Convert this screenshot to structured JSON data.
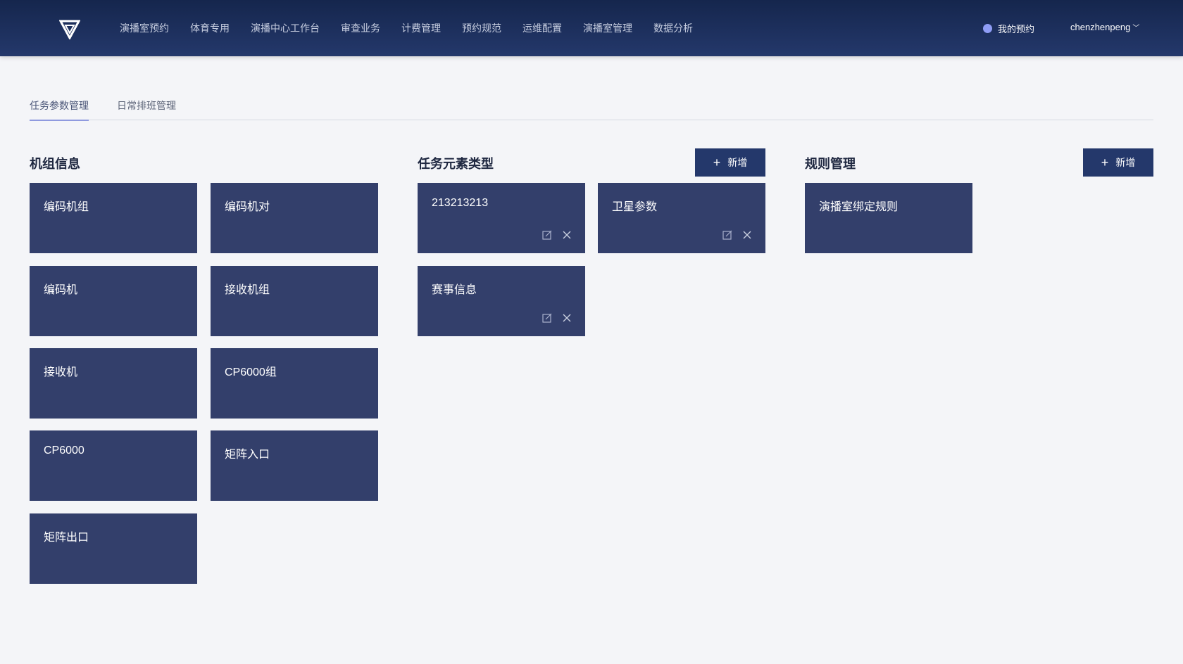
{
  "nav": {
    "logo_icon": "triangle-logo-icon",
    "items": [
      "演播室预约",
      "体育专用",
      "演播中心工作台",
      "审查业务",
      "计费管理",
      "预约规范",
      "运维配置",
      "演播室管理",
      "数据分析"
    ],
    "my_booking": "我的预约",
    "username": "chenzhenpeng"
  },
  "tabs": [
    "任务参数管理",
    "日常排班管理"
  ],
  "active_tab": 0,
  "sections": {
    "unit_info": {
      "title": "机组信息",
      "cards": [
        "编码机组",
        "编码机对",
        "编码机",
        "接收机组",
        "接收机",
        "CP6000组",
        "CP6000",
        "矩阵入口",
        "矩阵出口"
      ]
    },
    "task_element_types": {
      "title": "任务元素类型",
      "add_label": "新增",
      "cards": [
        "213213213",
        "卫星参数",
        "赛事信息"
      ]
    },
    "rule_management": {
      "title": "规则管理",
      "add_label": "新增",
      "cards": [
        "演播室绑定规则"
      ]
    }
  },
  "colors": {
    "nav_bg": "#1b2d5a",
    "card_bg": "#333f6b",
    "button_bg": "#24386b",
    "page_bg": "#f4f5f8"
  }
}
